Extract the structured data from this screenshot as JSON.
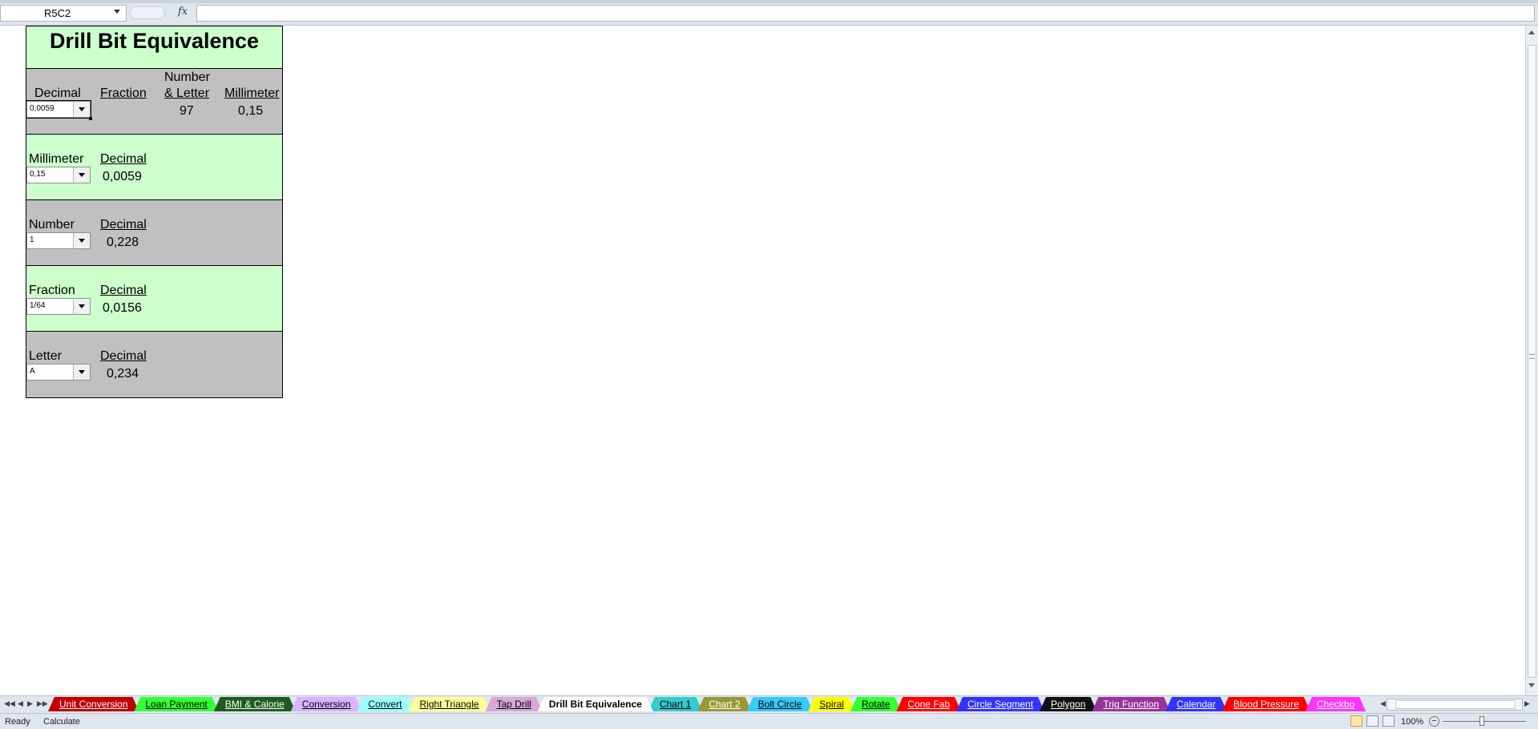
{
  "formula_bar": {
    "name_box": "R5C2",
    "fx_label": "fx",
    "formula_value": ""
  },
  "sheet": {
    "title": "Drill Bit Equivalence",
    "rows": [
      {
        "headers": [
          "Decimal",
          "Fraction",
          "Number\n& Letter",
          "Millimeter"
        ],
        "header_number_line1": "Number",
        "header_number_line2": "& Letter",
        "dropdown_value": "0,0059",
        "values": {
          "fraction": "",
          "number_letter": "97",
          "millimeter": "0,15"
        }
      },
      {
        "label": "Millimeter",
        "result_label": "Decimal",
        "dropdown_value": "0,15",
        "result": "0,0059"
      },
      {
        "label": "Number",
        "result_label": "Decimal",
        "dropdown_value": "1",
        "result": "0,228"
      },
      {
        "label": "Fraction",
        "result_label": "Decimal",
        "dropdown_value": "1/64",
        "result": "0,0156"
      },
      {
        "label": "Letter",
        "result_label": "Decimal",
        "dropdown_value": "A",
        "result": "0,234"
      }
    ]
  },
  "tabs": [
    {
      "label": "Unit Conversion",
      "bg": "#c00000",
      "fg": "#ffffff"
    },
    {
      "label": "Loan Payment",
      "bg": "#33ff33",
      "fg": "#000000"
    },
    {
      "label": "BMI & Calorie",
      "bg": "#1e5b1e",
      "fg": "#ffffff"
    },
    {
      "label": "Conversion",
      "bg": "#d9b3ff",
      "fg": "#000000"
    },
    {
      "label": "Convert",
      "bg": "#99ffff",
      "fg": "#000000"
    },
    {
      "label": "Right Triangle",
      "bg": "#ffff99",
      "fg": "#000000"
    },
    {
      "label": "Tap Drill",
      "bg": "#d8a8d8",
      "fg": "#000000"
    },
    {
      "label": "Drill Bit Equivalence",
      "bg": "#ffffff",
      "fg": "#000000",
      "active": true
    },
    {
      "label": "Chart 1",
      "bg": "#33cccc",
      "fg": "#000000"
    },
    {
      "label": "Chart 2",
      "bg": "#999933",
      "fg": "#ffffff"
    },
    {
      "label": "Bolt Circle",
      "bg": "#33ccff",
      "fg": "#000000"
    },
    {
      "label": "Spiral",
      "bg": "#ffff00",
      "fg": "#000000"
    },
    {
      "label": "Rotate",
      "bg": "#33ff33",
      "fg": "#000000"
    },
    {
      "label": "Cone Fab",
      "bg": "#ff0000",
      "fg": "#ffffff"
    },
    {
      "label": "Circle Segment",
      "bg": "#3333ff",
      "fg": "#ffffff"
    },
    {
      "label": "Polygon",
      "bg": "#111111",
      "fg": "#ffffff"
    },
    {
      "label": "Trig Function",
      "bg": "#993399",
      "fg": "#ffffff"
    },
    {
      "label": "Calendar",
      "bg": "#3333ff",
      "fg": "#ffffff"
    },
    {
      "label": "Blood Pressure",
      "bg": "#ff0000",
      "fg": "#ffffff"
    },
    {
      "label": "Checkbo",
      "bg": "#ff33ff",
      "fg": "#ffffff"
    }
  ],
  "status": {
    "ready": "Ready",
    "calculate": "Calculate",
    "zoom": "100%"
  }
}
